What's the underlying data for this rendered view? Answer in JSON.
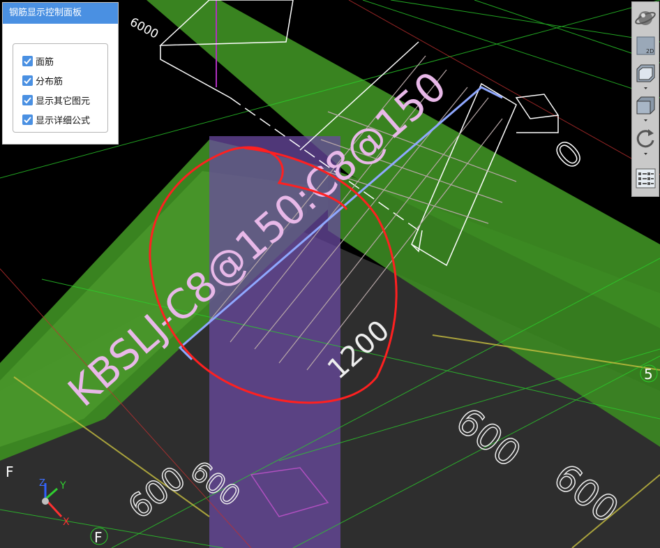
{
  "panel": {
    "title": "钢筋显示控制面板",
    "options": [
      {
        "label": "面筋",
        "checked": true
      },
      {
        "label": "分布筋",
        "checked": true
      },
      {
        "label": "显示其它图元",
        "checked": true
      },
      {
        "label": "显示详细公式",
        "checked": true
      }
    ]
  },
  "toolbar": {
    "view_2d_label": "2D",
    "icons": [
      "orbit-icon",
      "view-2d-icon",
      "view-3d-box-icon",
      "solid-box-icon",
      "rotate-icon",
      "display-settings-icon"
    ]
  },
  "scene": {
    "rebar_annotation": "KBSLJ-C8@150:C8@150",
    "dim_6000_top": "6000",
    "dim_0": "0",
    "dim_1200": "1200",
    "dim_600_a": "600",
    "dim_600_b": "600",
    "dim_600_c": "600",
    "dim_600_d": "600",
    "axis_5": "5",
    "axis_f_left": "F",
    "axis_f_bottom": "F",
    "coord_x": "X",
    "coord_y": "Y",
    "coord_z": "Z"
  },
  "colors": {
    "green_band": "#3a8c20",
    "annotation_pink": "#e8b8e8",
    "rebar_blue": "#8fa8ff",
    "column_purple": "#6a4aa0",
    "markup_red": "#ff2020",
    "panel_blue": "#4a90e2"
  }
}
